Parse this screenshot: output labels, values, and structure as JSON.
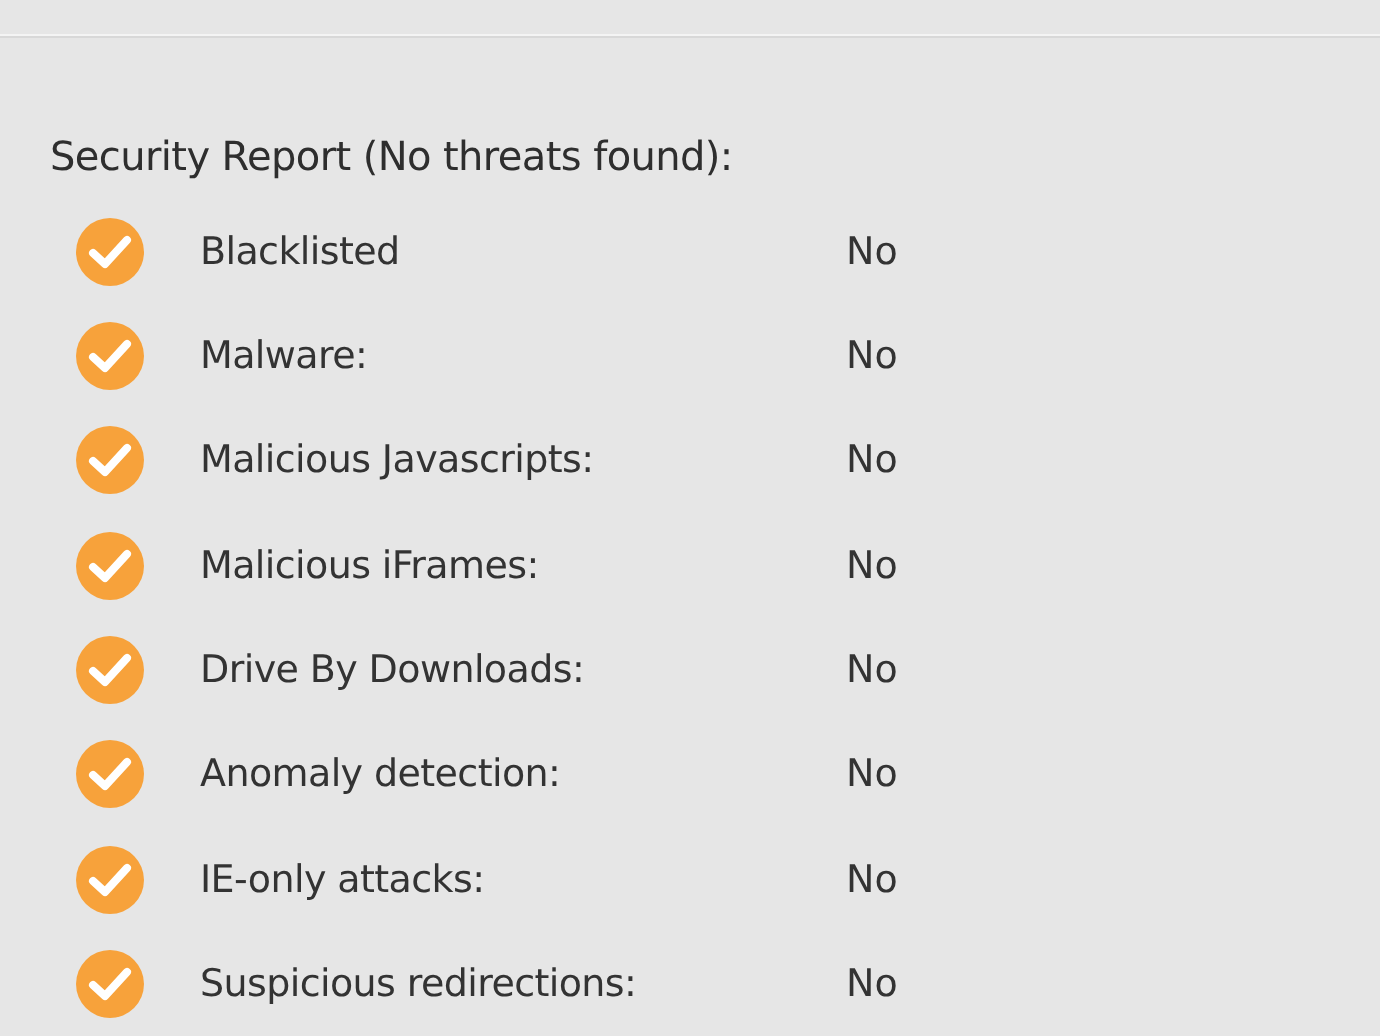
{
  "title": "Security Report (No threats found):",
  "checks": [
    {
      "label": "Blacklisted",
      "value": "No",
      "passed": true
    },
    {
      "label": "Malware:",
      "value": "No",
      "passed": true
    },
    {
      "label": "Malicious Javascripts:",
      "value": "No",
      "passed": true
    },
    {
      "label": "Malicious iFrames:",
      "value": "No",
      "passed": true
    },
    {
      "label": "Drive By Downloads:",
      "value": "No",
      "passed": true
    },
    {
      "label": "Anomaly detection:",
      "value": "No",
      "passed": true
    },
    {
      "label": "IE-only attacks:",
      "value": "No",
      "passed": true
    },
    {
      "label": "Suspicious redirections:",
      "value": "No",
      "passed": true
    }
  ]
}
